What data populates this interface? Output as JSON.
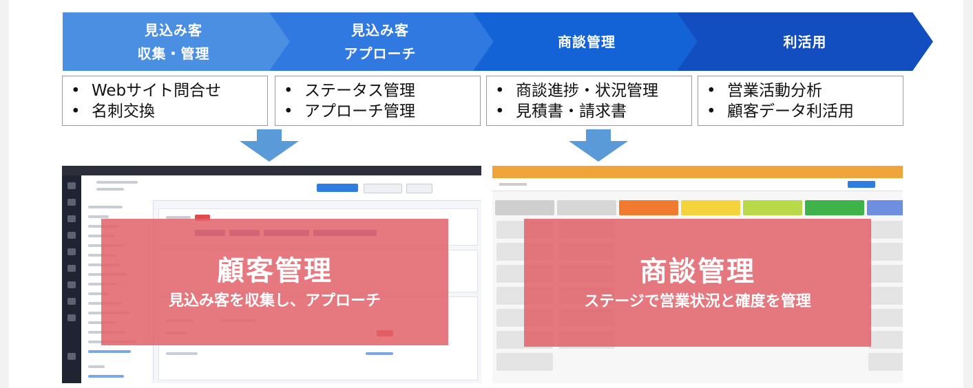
{
  "steps": [
    {
      "line1": "見込み客",
      "line2": "収集・管理"
    },
    {
      "line1": "見込み客",
      "line2": "アプローチ"
    },
    {
      "line1": "商談管理",
      "line2": ""
    },
    {
      "line1": "利活用",
      "line2": ""
    }
  ],
  "details": [
    {
      "items": [
        "Webサイト問合せ",
        "名刺交換"
      ]
    },
    {
      "items": [
        "ステータス管理",
        "アプローチ管理"
      ]
    },
    {
      "items": [
        "商談進捗・状況管理",
        "見積書・請求書"
      ]
    },
    {
      "items": [
        "営業活動分析",
        "顧客データ利活用"
      ]
    }
  ],
  "bullet": "•",
  "panels": [
    {
      "title": "顧客管理",
      "subtitle": "見込み客を収集し、アプローチ"
    },
    {
      "title": "商談管理",
      "subtitle": "ステージで営業状況と確度を管理"
    }
  ],
  "colors": {
    "step1": "#4b8fe3",
    "step2": "#2f79e0",
    "step3": "#1463d6",
    "step4": "#124ebf",
    "arrow": "#5b9ad8",
    "overlay": "#e2626a",
    "deal_topbar": "#f0a43a"
  }
}
